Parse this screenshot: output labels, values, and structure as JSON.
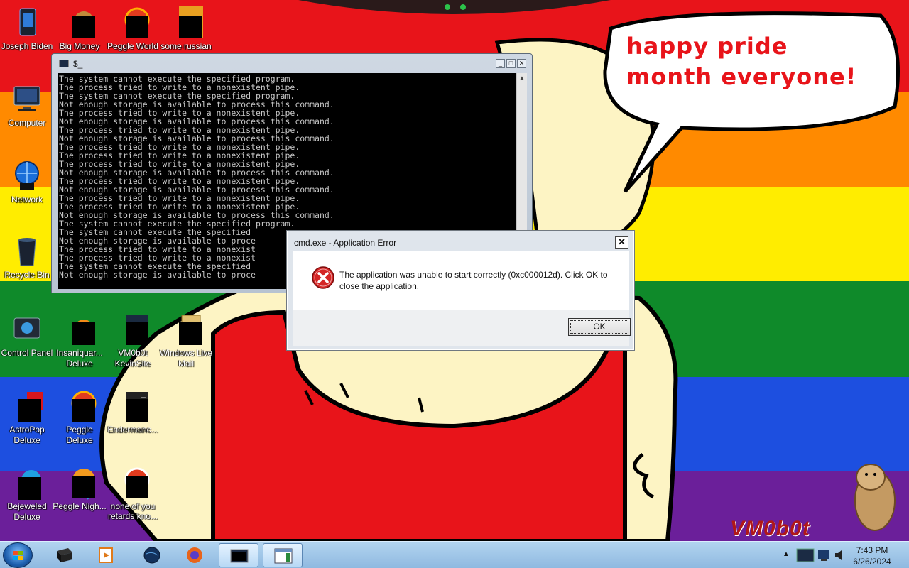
{
  "desktop": {
    "icons": [
      {
        "label": "Joseph Biden",
        "icon": "joseph-biden-icon"
      },
      {
        "label": "Big Money",
        "icon": "big-money-icon"
      },
      {
        "label": "Peggle World",
        "icon": "peggle-world-icon"
      },
      {
        "label": "some russian",
        "icon": "some-russian-icon"
      },
      {
        "label": "Computer",
        "icon": "computer-icon"
      },
      {
        "label": "Network",
        "icon": "network-icon"
      },
      {
        "label": "Recycle Bin",
        "icon": "recycle-bin-icon"
      },
      {
        "label": "Control Panel",
        "icon": "control-panel-icon"
      },
      {
        "label": "Insaniquar... Deluxe",
        "icon": "insaniquarium-icon"
      },
      {
        "label": "VM0b0t KevinSite",
        "icon": "vm0b0t-kevinsite-icon"
      },
      {
        "label": "Windows Live Mail",
        "icon": "windows-live-mail-icon"
      },
      {
        "label": "AstroPop Deluxe",
        "icon": "astropop-icon"
      },
      {
        "label": "Peggle Deluxe",
        "icon": "peggle-deluxe-icon"
      },
      {
        "label": "Endermanc...",
        "icon": "endermanch-icon"
      },
      {
        "label": "Bejeweled Deluxe",
        "icon": "bejeweled-icon"
      },
      {
        "label": "Peggle Nigh...",
        "icon": "peggle-nights-icon"
      },
      {
        "label": "none of you retards kno...",
        "icon": "none-of-you-icon"
      }
    ]
  },
  "wallpaper": {
    "speech_bubble": "happy pride month everyone!",
    "watermark": "VM0b0t",
    "stripe_colors": [
      "#e8141a",
      "#ff8a00",
      "#ffed00",
      "#0f8a2a",
      "#1d4fe0",
      "#6b1f9a"
    ]
  },
  "console": {
    "title": "$_",
    "lines": [
      "The system cannot execute the specified program.",
      "The process tried to write to a nonexistent pipe.",
      "The system cannot execute the specified program.",
      "Not enough storage is available to process this command.",
      "The process tried to write to a nonexistent pipe.",
      "Not enough storage is available to process this command.",
      "The process tried to write to a nonexistent pipe.",
      "Not enough storage is available to process this command.",
      "The process tried to write to a nonexistent pipe.",
      "The process tried to write to a nonexistent pipe.",
      "The process tried to write to a nonexistent pipe.",
      "Not enough storage is available to process this command.",
      "The process tried to write to a nonexistent pipe.",
      "Not enough storage is available to process this command.",
      "The process tried to write to a nonexistent pipe.",
      "The process tried to write to a nonexistent pipe.",
      "Not enough storage is available to process this command.",
      "The system cannot execute the specified program.",
      "The system cannot execute the specified",
      "Not enough storage is available to proce",
      "The process tried to write to a nonexist",
      "The process tried to write to a nonexist",
      "The system cannot execute the specified",
      "Not enough storage is available to proce"
    ]
  },
  "dialog": {
    "title": "cmd.exe - Application Error",
    "message": "The application was unable to start correctly (0xc000012d). Click OK to close the application.",
    "ok_label": "OK",
    "close_label": "✕"
  },
  "taskbar": {
    "items": [
      {
        "icon": "media-center-icon"
      },
      {
        "icon": "media-player-icon"
      },
      {
        "icon": "globe-icon"
      },
      {
        "icon": "firefox-icon"
      },
      {
        "icon": "cmd-window-icon"
      },
      {
        "icon": "window-icon"
      }
    ],
    "time": "7:43 PM",
    "date": "6/26/2024"
  }
}
